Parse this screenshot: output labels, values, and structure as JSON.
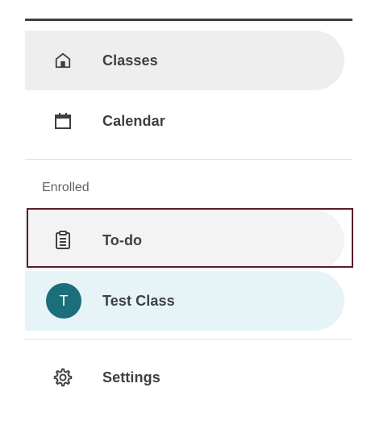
{
  "nav": {
    "classes": {
      "label": "Classes",
      "icon": "home-icon"
    },
    "calendar": {
      "label": "Calendar",
      "icon": "calendar-icon"
    },
    "enrolled_heading": "Enrolled",
    "todo": {
      "label": "To-do",
      "icon": "clipboard-icon"
    },
    "test_class": {
      "label": "Test Class",
      "avatar_letter": "T",
      "avatar_color": "#1b6f7b"
    },
    "settings": {
      "label": "Settings",
      "icon": "gear-icon"
    }
  },
  "colors": {
    "selected_background": "#e7f4f7",
    "hover_background": "#eeeeee",
    "focus_outline": "#5a1e25"
  }
}
